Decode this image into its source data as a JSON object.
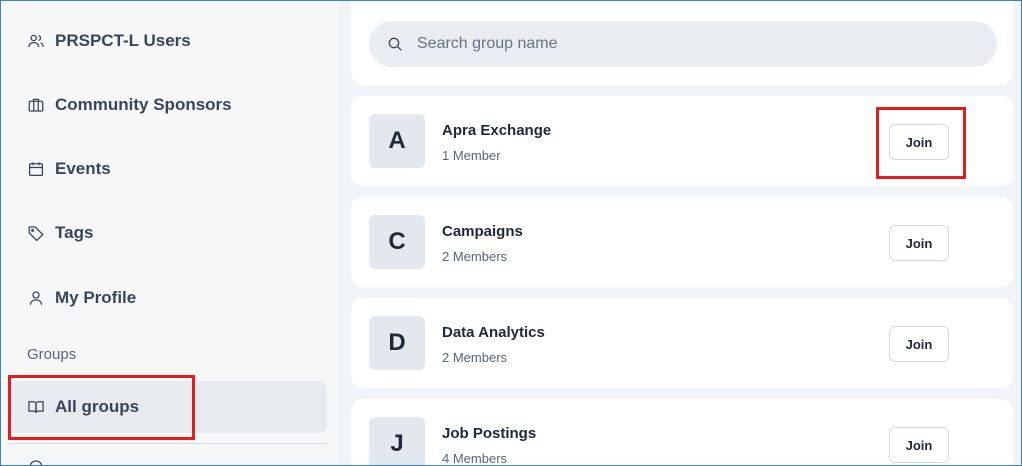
{
  "sidebar": {
    "items": [
      {
        "label": "PRSPCT-L Users",
        "icon": "users-icon"
      },
      {
        "label": "Community Sponsors",
        "icon": "briefcase-icon"
      },
      {
        "label": "Events",
        "icon": "calendar-icon"
      },
      {
        "label": "Tags",
        "icon": "tag-icon"
      },
      {
        "label": "My Profile",
        "icon": "user-icon"
      }
    ],
    "section_label": "Groups",
    "active_item": {
      "label": "All groups",
      "icon": "book-icon"
    }
  },
  "search": {
    "placeholder": "Search group name"
  },
  "groups": [
    {
      "initial": "A",
      "name": "Apra Exchange",
      "members": "1 Member",
      "action": "Join"
    },
    {
      "initial": "C",
      "name": "Campaigns",
      "members": "2 Members",
      "action": "Join"
    },
    {
      "initial": "D",
      "name": "Data Analytics",
      "members": "2 Members",
      "action": "Join"
    },
    {
      "initial": "J",
      "name": "Job Postings",
      "members": "4 Members",
      "action": "Join"
    }
  ],
  "colors": {
    "highlight": "#e11d1d",
    "frame_border": "#3b82c4",
    "background": "#f1f4f8"
  }
}
